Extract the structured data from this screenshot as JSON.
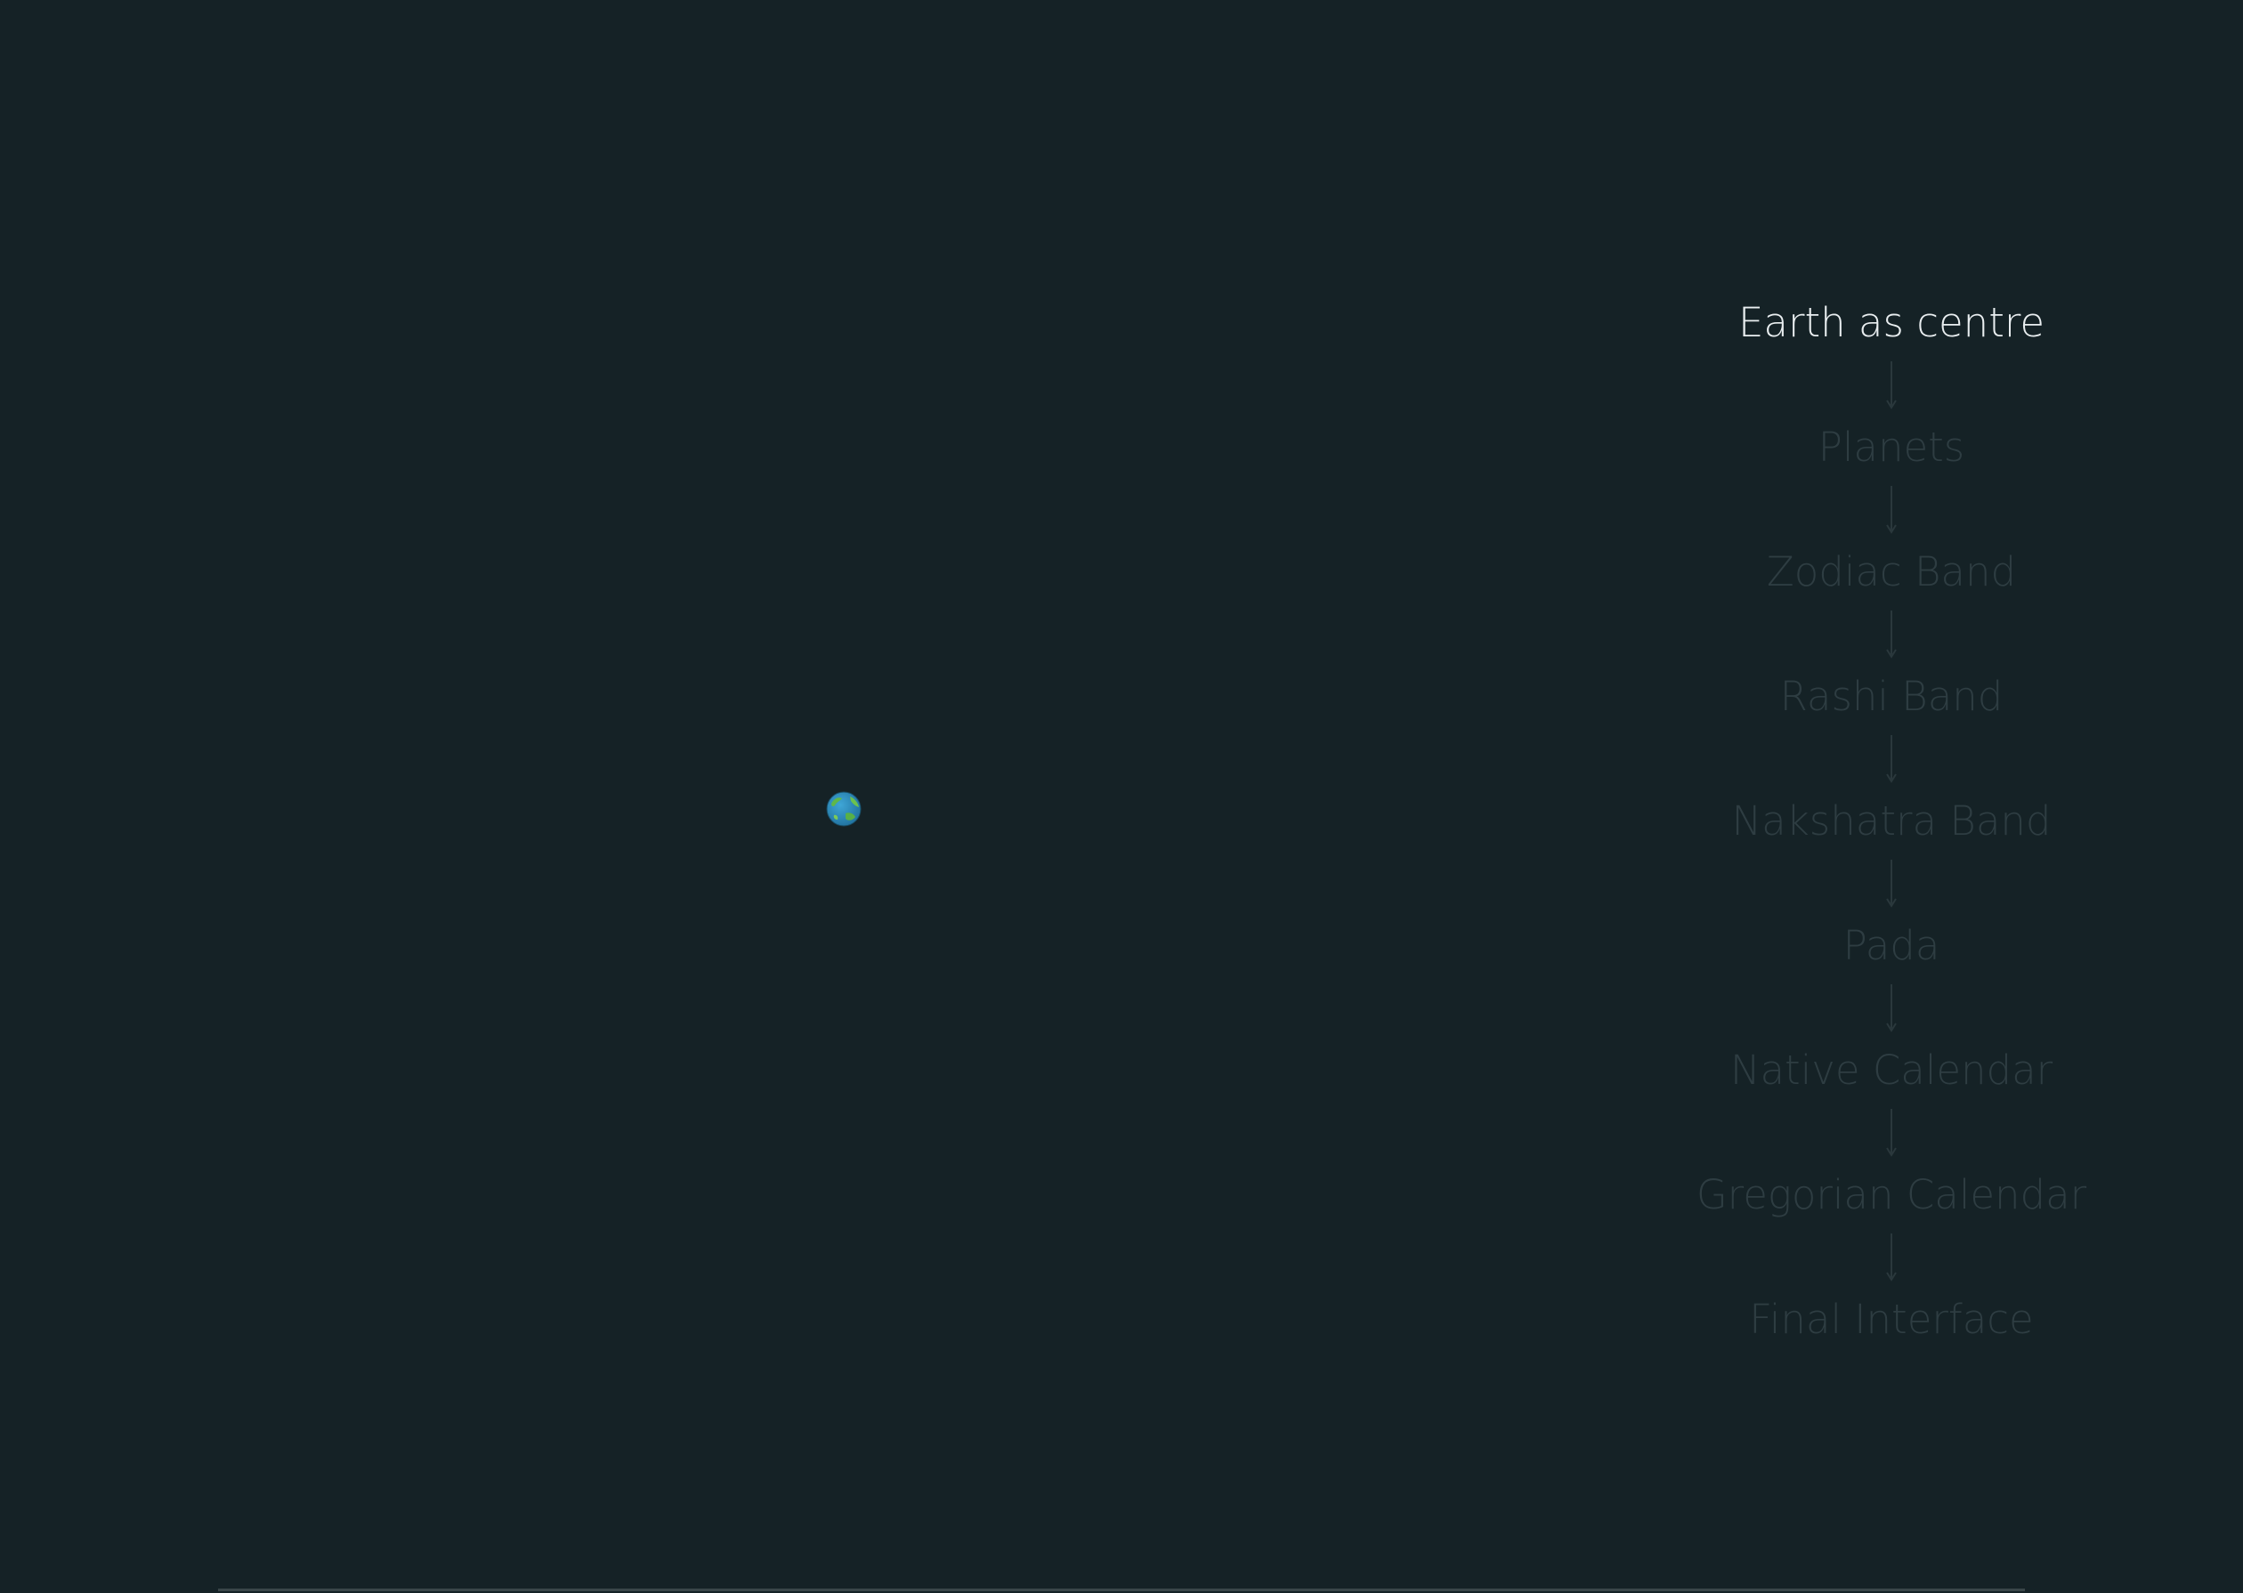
{
  "steps": [
    {
      "label": "Earth as centre",
      "active": true
    },
    {
      "label": "Planets",
      "active": false
    },
    {
      "label": "Zodiac Band",
      "active": false
    },
    {
      "label": "Rashi Band",
      "active": false
    },
    {
      "label": "Nakshatra Band",
      "active": false
    },
    {
      "label": "Pada",
      "active": false
    },
    {
      "label": "Native Calendar",
      "active": false
    },
    {
      "label": "Gregorian Calendar",
      "active": false
    },
    {
      "label": "Final Interface",
      "active": false
    }
  ],
  "earth": {
    "icon": "earth-globe-icon"
  },
  "colors": {
    "background": "#152226",
    "active_text": "#e9eef0",
    "inactive_text": "#2e3d42",
    "arrow": "#2a383c"
  }
}
